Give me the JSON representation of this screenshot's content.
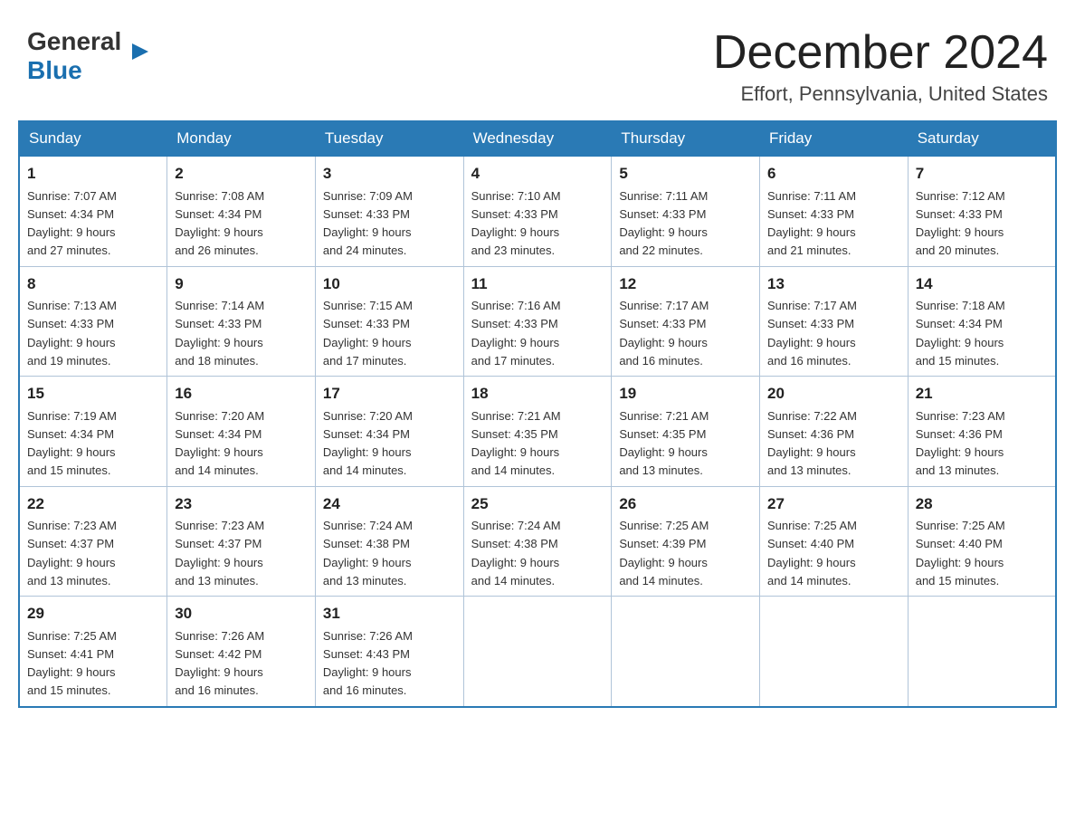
{
  "header": {
    "logo": {
      "general": "General",
      "blue": "Blue"
    },
    "title": "December 2024",
    "location": "Effort, Pennsylvania, United States"
  },
  "weekdays": [
    "Sunday",
    "Monday",
    "Tuesday",
    "Wednesday",
    "Thursday",
    "Friday",
    "Saturday"
  ],
  "weeks": [
    [
      {
        "day": "1",
        "sunrise": "7:07 AM",
        "sunset": "4:34 PM",
        "daylight": "9 hours and 27 minutes."
      },
      {
        "day": "2",
        "sunrise": "7:08 AM",
        "sunset": "4:34 PM",
        "daylight": "9 hours and 26 minutes."
      },
      {
        "day": "3",
        "sunrise": "7:09 AM",
        "sunset": "4:33 PM",
        "daylight": "9 hours and 24 minutes."
      },
      {
        "day": "4",
        "sunrise": "7:10 AM",
        "sunset": "4:33 PM",
        "daylight": "9 hours and 23 minutes."
      },
      {
        "day": "5",
        "sunrise": "7:11 AM",
        "sunset": "4:33 PM",
        "daylight": "9 hours and 22 minutes."
      },
      {
        "day": "6",
        "sunrise": "7:11 AM",
        "sunset": "4:33 PM",
        "daylight": "9 hours and 21 minutes."
      },
      {
        "day": "7",
        "sunrise": "7:12 AM",
        "sunset": "4:33 PM",
        "daylight": "9 hours and 20 minutes."
      }
    ],
    [
      {
        "day": "8",
        "sunrise": "7:13 AM",
        "sunset": "4:33 PM",
        "daylight": "9 hours and 19 minutes."
      },
      {
        "day": "9",
        "sunrise": "7:14 AM",
        "sunset": "4:33 PM",
        "daylight": "9 hours and 18 minutes."
      },
      {
        "day": "10",
        "sunrise": "7:15 AM",
        "sunset": "4:33 PM",
        "daylight": "9 hours and 17 minutes."
      },
      {
        "day": "11",
        "sunrise": "7:16 AM",
        "sunset": "4:33 PM",
        "daylight": "9 hours and 17 minutes."
      },
      {
        "day": "12",
        "sunrise": "7:17 AM",
        "sunset": "4:33 PM",
        "daylight": "9 hours and 16 minutes."
      },
      {
        "day": "13",
        "sunrise": "7:17 AM",
        "sunset": "4:33 PM",
        "daylight": "9 hours and 16 minutes."
      },
      {
        "day": "14",
        "sunrise": "7:18 AM",
        "sunset": "4:34 PM",
        "daylight": "9 hours and 15 minutes."
      }
    ],
    [
      {
        "day": "15",
        "sunrise": "7:19 AM",
        "sunset": "4:34 PM",
        "daylight": "9 hours and 15 minutes."
      },
      {
        "day": "16",
        "sunrise": "7:20 AM",
        "sunset": "4:34 PM",
        "daylight": "9 hours and 14 minutes."
      },
      {
        "day": "17",
        "sunrise": "7:20 AM",
        "sunset": "4:34 PM",
        "daylight": "9 hours and 14 minutes."
      },
      {
        "day": "18",
        "sunrise": "7:21 AM",
        "sunset": "4:35 PM",
        "daylight": "9 hours and 14 minutes."
      },
      {
        "day": "19",
        "sunrise": "7:21 AM",
        "sunset": "4:35 PM",
        "daylight": "9 hours and 13 minutes."
      },
      {
        "day": "20",
        "sunrise": "7:22 AM",
        "sunset": "4:36 PM",
        "daylight": "9 hours and 13 minutes."
      },
      {
        "day": "21",
        "sunrise": "7:23 AM",
        "sunset": "4:36 PM",
        "daylight": "9 hours and 13 minutes."
      }
    ],
    [
      {
        "day": "22",
        "sunrise": "7:23 AM",
        "sunset": "4:37 PM",
        "daylight": "9 hours and 13 minutes."
      },
      {
        "day": "23",
        "sunrise": "7:23 AM",
        "sunset": "4:37 PM",
        "daylight": "9 hours and 13 minutes."
      },
      {
        "day": "24",
        "sunrise": "7:24 AM",
        "sunset": "4:38 PM",
        "daylight": "9 hours and 13 minutes."
      },
      {
        "day": "25",
        "sunrise": "7:24 AM",
        "sunset": "4:38 PM",
        "daylight": "9 hours and 14 minutes."
      },
      {
        "day": "26",
        "sunrise": "7:25 AM",
        "sunset": "4:39 PM",
        "daylight": "9 hours and 14 minutes."
      },
      {
        "day": "27",
        "sunrise": "7:25 AM",
        "sunset": "4:40 PM",
        "daylight": "9 hours and 14 minutes."
      },
      {
        "day": "28",
        "sunrise": "7:25 AM",
        "sunset": "4:40 PM",
        "daylight": "9 hours and 15 minutes."
      }
    ],
    [
      {
        "day": "29",
        "sunrise": "7:25 AM",
        "sunset": "4:41 PM",
        "daylight": "9 hours and 15 minutes."
      },
      {
        "day": "30",
        "sunrise": "7:26 AM",
        "sunset": "4:42 PM",
        "daylight": "9 hours and 16 minutes."
      },
      {
        "day": "31",
        "sunrise": "7:26 AM",
        "sunset": "4:43 PM",
        "daylight": "9 hours and 16 minutes."
      },
      null,
      null,
      null,
      null
    ]
  ],
  "labels": {
    "sunrise": "Sunrise:",
    "sunset": "Sunset:",
    "daylight": "Daylight:"
  }
}
